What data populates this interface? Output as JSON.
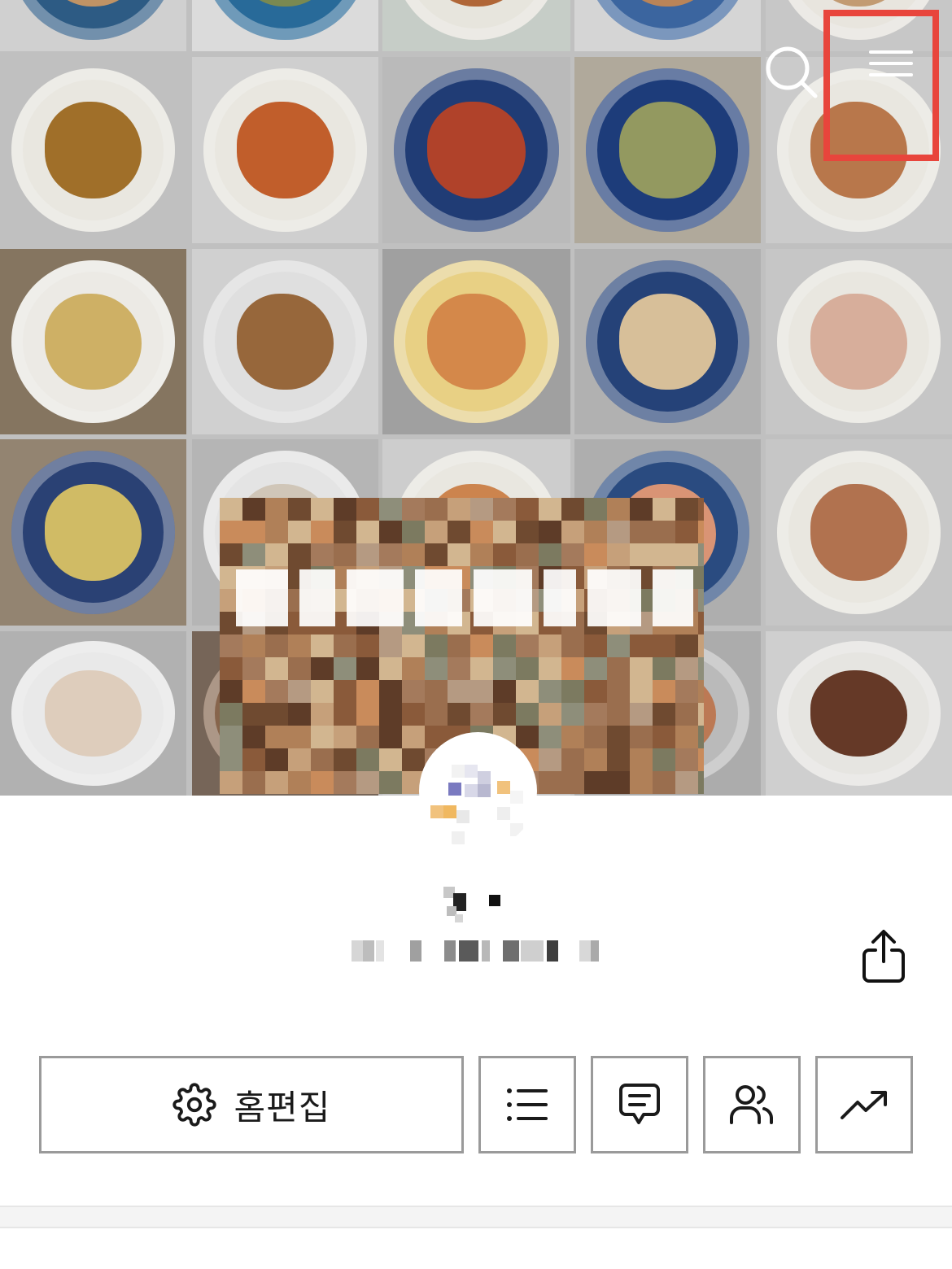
{
  "colors": {
    "highlight": "#e8453c",
    "button_border": "#9a9a9a",
    "text": "#1a1a1a",
    "divider": "#f4f4f4"
  },
  "cover": {
    "tiles": [
      {
        "plate": "#2f5f8a",
        "food": "#c89a6a",
        "bg": "#d9d9d9"
      },
      {
        "plate": "#2a6fa0",
        "food": "#7f8f55",
        "bg": "#e4e4e4"
      },
      {
        "plate": "#f1efe6",
        "food": "#b86b3a",
        "bg": "#cfd6d0"
      },
      {
        "plate": "#3e6aa6",
        "food": "#c28a5c",
        "bg": "#dedede"
      },
      {
        "plate": "#f2efe8",
        "food": "#caa277",
        "bg": "#d0d0d0"
      },
      {
        "plate": "#f3f1ea",
        "food": "#a7742b",
        "bg": "#c8c8c8"
      },
      {
        "plate": "#f3f1ea",
        "food": "#c9622d",
        "bg": "#d8d8d8"
      },
      {
        "plate": "#223f7a",
        "food": "#b8452c",
        "bg": "#c2c2c2"
      },
      {
        "plate": "#1f3f7f",
        "food": "#9aa064",
        "bg": "#b8b0a2"
      },
      {
        "plate": "#f3f1ea",
        "food": "#c07c4f",
        "bg": "#d4d4d4"
      },
      {
        "plate": "#f6f4ef",
        "food": "#d7b86a",
        "bg": "#8b7a64"
      },
      {
        "plate": "#e9e9e9",
        "food": "#9e6c3e",
        "bg": "#d9d9d9"
      },
      {
        "plate": "#f2d98a",
        "food": "#dd8e4e",
        "bg": "#a7a7a7"
      },
      {
        "plate": "#27457d",
        "food": "#e0c7a0",
        "bg": "#b9b9b9"
      },
      {
        "plate": "#f3f1ea",
        "food": "#e0b6a2",
        "bg": "#cfcfcf"
      },
      {
        "plate": "#2c4479",
        "food": "#d9c36a",
        "bg": "#9a8a76"
      },
      {
        "plate": "#eeeeee",
        "food": "#d9cfc0",
        "bg": "#bdbdbd"
      },
      {
        "plate": "#f3f1ea",
        "food": "#d58a52",
        "bg": "#d6d6d6"
      },
      {
        "plate": "#2c4f86",
        "food": "#e29b7a",
        "bg": "#b6b6b6"
      },
      {
        "plate": "#f3f1ea",
        "food": "#b97753",
        "bg": "#cfcfcf"
      },
      {
        "plate": "#f3f3f3",
        "food": "#e8d6c4",
        "bg": "#b9b9b9"
      },
      {
        "plate": "#8d6a50",
        "food": "#a78060",
        "bg": "#7b6a5c"
      },
      {
        "plate": "#ededed",
        "food": "#a87a5a",
        "bg": "#d0d0d0"
      },
      {
        "plate": "#c2c2c2",
        "food": "#c47e58",
        "bg": "#b4b4b4"
      },
      {
        "plate": "#f0efeb",
        "food": "#6a3c29",
        "bg": "#d8d8d8"
      }
    ],
    "pixel_palette": [
      "#8a5a3a",
      "#b08058",
      "#6f4a30",
      "#c6a07a",
      "#9a6e4e",
      "#d2b690",
      "#5e3c28",
      "#a47a5c",
      "#7c7a60",
      "#b59a82",
      "#8e8e7a",
      "#c98b5b"
    ]
  },
  "header": {
    "search_icon": "search-icon",
    "menu_icon": "hamburger-menu-icon"
  },
  "profile": {
    "avatar_icon": "avatar",
    "share_icon": "share-icon"
  },
  "actions": {
    "edit_home_label": "홈편집",
    "edit_icon": "gear-icon",
    "list_icon": "list-icon",
    "comment_icon": "comment-icon",
    "users_icon": "users-icon",
    "stats_icon": "trending-up-icon"
  }
}
